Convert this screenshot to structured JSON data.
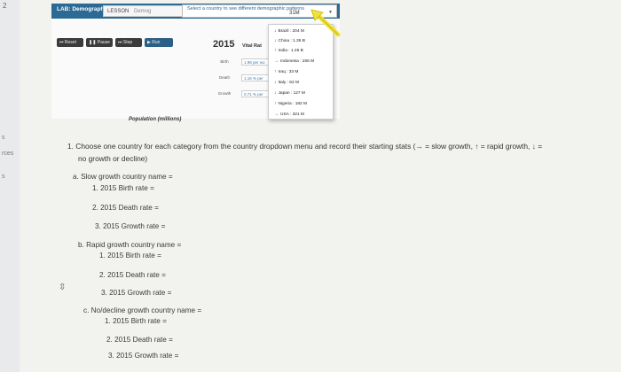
{
  "side": {
    "num": "2",
    "frags": [
      "s",
      "rces",
      "s"
    ]
  },
  "app": {
    "title": "LAB: Demographics",
    "lesson_label": "LESSON",
    "lesson_value": "Demog",
    "select_placeholder": "Select a country to see different demographic patterns",
    "select_value": "31M",
    "buttons": [
      "Reset",
      "Pause",
      "Step",
      "Run"
    ],
    "year": "2015",
    "vital_rates": "Vital Rat",
    "stats": [
      {
        "label": "Birth",
        "value": "1.98 per wo"
      },
      {
        "label": "Death",
        "value": "1.16 % per"
      },
      {
        "label": "Growth",
        "value": "0.71 % per"
      }
    ],
    "dropdown": [
      {
        "icon": "↓",
        "text": "Brazil : 204 M"
      },
      {
        "icon": "↓",
        "text": "China : 1.36 B"
      },
      {
        "icon": "↑",
        "text": "India : 1.25 B"
      },
      {
        "icon": "→",
        "text": "Indonesia : 255 M"
      },
      {
        "icon": "↑",
        "text": "Iraq : 33 M"
      },
      {
        "icon": "↓",
        "text": "Italy : 62 M"
      },
      {
        "icon": "↓",
        "text": "Japan : 127 M"
      },
      {
        "icon": "↑",
        "text": "Nigeria : 182 M"
      },
      {
        "icon": "→",
        "text": "USA : 321 M"
      }
    ],
    "population_label": "Population (millions)"
  },
  "worksheet": {
    "question": "1. Choose one country for each category from the country dropdown menu and record their starting stats  (→ = slow growth, ↑ = rapid growth, ↓ =",
    "question_cont": "no growth or decline)",
    "a_title": "a. Slow growth country name =",
    "a1": "1. 2015 Birth rate =",
    "a2": "2. 2015 Death rate =",
    "a3": "3. 2015 Growth rate =",
    "b_title": "b. Rapid growth country name =",
    "b1": "1. 2015 Birth rate =",
    "b2": "2. 2015 Death rate =",
    "b3": "3. 2015 Growth rate =",
    "c_title": "c. No/decline growth country name =",
    "c1": "1. 2015 Birth rate =",
    "c2": "2. 2015 Death rate =",
    "c3": "3. 2015 Growth rate ="
  }
}
